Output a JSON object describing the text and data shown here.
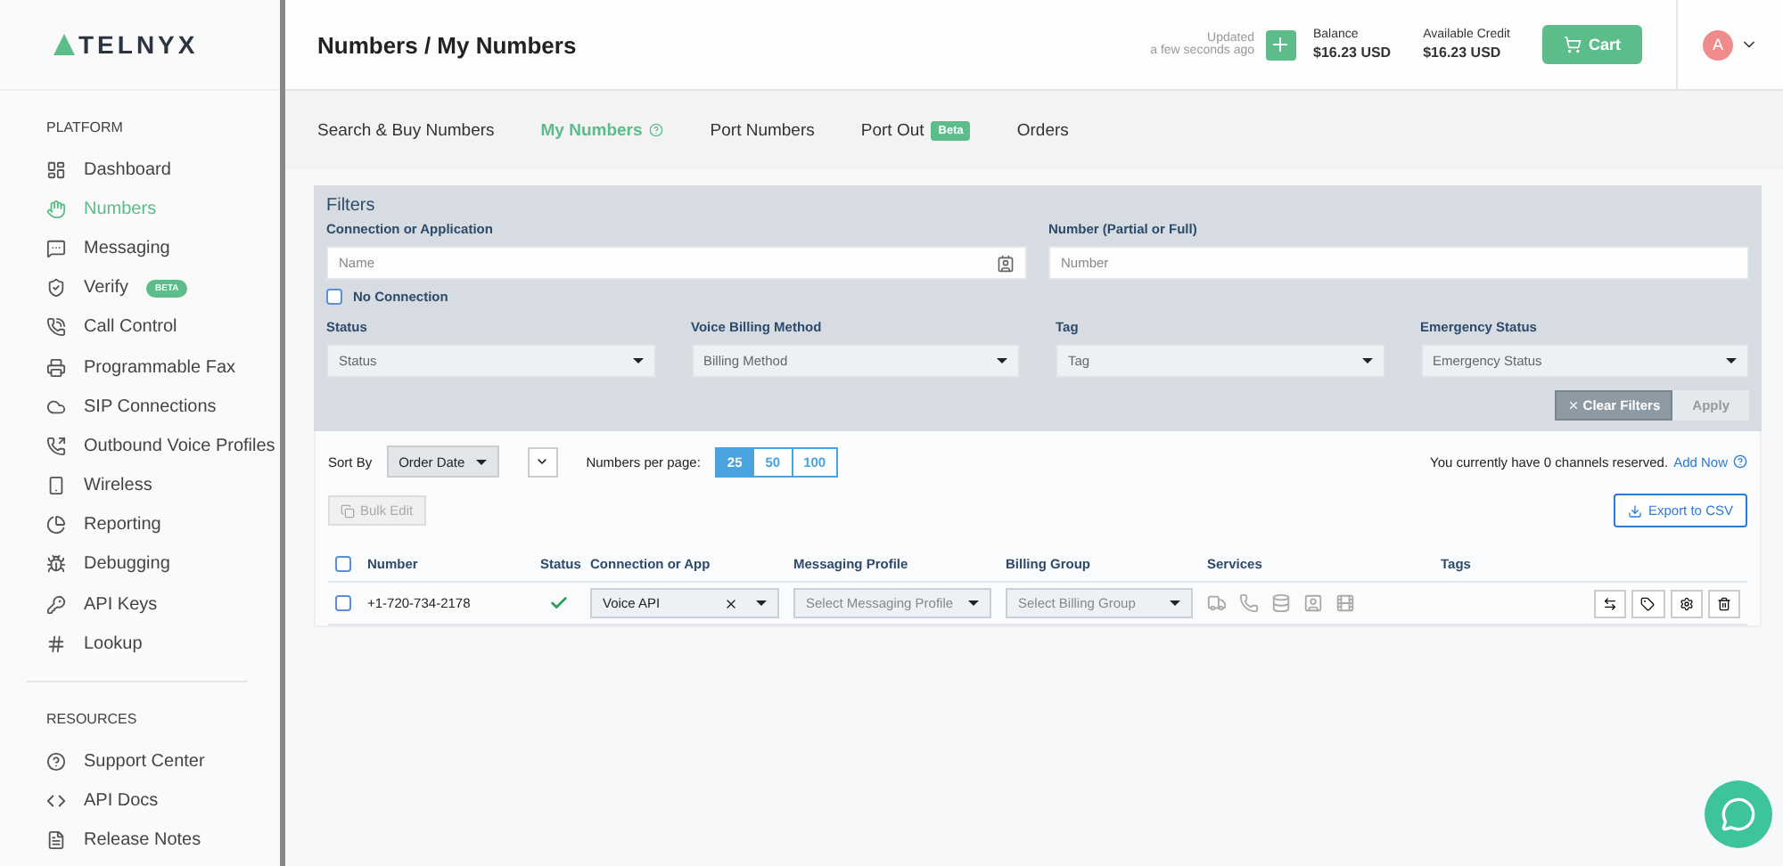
{
  "brand": "TELNYX",
  "sidebar": {
    "sections": [
      {
        "title": "PLATFORM",
        "items": [
          {
            "label": "Dashboard",
            "selected": false
          },
          {
            "label": "Numbers",
            "selected": true
          },
          {
            "label": "Messaging",
            "selected": false
          },
          {
            "label": "Verify",
            "selected": false,
            "badge": "BETA"
          },
          {
            "label": "Call Control",
            "selected": false
          },
          {
            "label": "Programmable Fax",
            "selected": false
          },
          {
            "label": "SIP Connections",
            "selected": false
          },
          {
            "label": "Outbound Voice Profiles",
            "selected": false
          },
          {
            "label": "Wireless",
            "selected": false
          },
          {
            "label": "Reporting",
            "selected": false
          },
          {
            "label": "Debugging",
            "selected": false
          },
          {
            "label": "API Keys",
            "selected": false
          },
          {
            "label": "Lookup",
            "selected": false
          }
        ]
      },
      {
        "title": "RESOURCES",
        "items": [
          {
            "label": "Support Center",
            "selected": false
          },
          {
            "label": "API Docs",
            "selected": false
          },
          {
            "label": "Release Notes",
            "selected": false
          }
        ]
      }
    ]
  },
  "header": {
    "title": "Numbers / My Numbers",
    "updated_label": "Updated",
    "updated_time": "a few seconds ago",
    "balance_label": "Balance",
    "balance": "$16.23 USD",
    "credit_label": "Available Credit",
    "credit": "$16.23 USD",
    "cart": "Cart",
    "avatar": "A"
  },
  "tabs": [
    {
      "label": "Search & Buy Numbers",
      "selected": false
    },
    {
      "label": "My Numbers",
      "selected": true,
      "help": true
    },
    {
      "label": "Port Numbers",
      "selected": false
    },
    {
      "label": "Port Out",
      "selected": false,
      "badge": "Beta"
    },
    {
      "label": "Orders",
      "selected": false
    }
  ],
  "filters": {
    "title": "Filters",
    "connection": {
      "label": "Connection or Application",
      "placeholder": "Name"
    },
    "number": {
      "label": "Number (Partial or Full)",
      "placeholder": "Number"
    },
    "no_connection": {
      "label": "No Connection",
      "checked": false
    },
    "selects": [
      {
        "label": "Status",
        "value": "Status"
      },
      {
        "label": "Voice Billing Method",
        "value": "Billing Method"
      },
      {
        "label": "Tag",
        "value": "Tag"
      },
      {
        "label": "Emergency Status",
        "value": "Emergency Status"
      }
    ],
    "clear": "Clear Filters",
    "apply": "Apply"
  },
  "toolbar": {
    "sort_label": "Sort By",
    "sort_value": "Order Date",
    "per_page_label": "Numbers per page:",
    "per_page": [
      {
        "label": "25",
        "selected": true
      },
      {
        "label": "50",
        "selected": false
      },
      {
        "label": "100",
        "selected": false
      }
    ],
    "channels_text": "You currently have 0 channels reserved.",
    "add_now": "Add Now",
    "bulk_edit": "Bulk Edit",
    "export": "Export to CSV"
  },
  "table": {
    "columns": [
      "Number",
      "Status",
      "Connection or App",
      "Messaging Profile",
      "Billing Group",
      "Services",
      "Tags"
    ],
    "select_all_checked": false,
    "rows": [
      {
        "checked": false,
        "number": "+1-720-734-2178",
        "status_ok": true,
        "connection": "Voice API",
        "messaging": "Select Messaging Profile",
        "billing": "Select Billing Group"
      }
    ]
  }
}
